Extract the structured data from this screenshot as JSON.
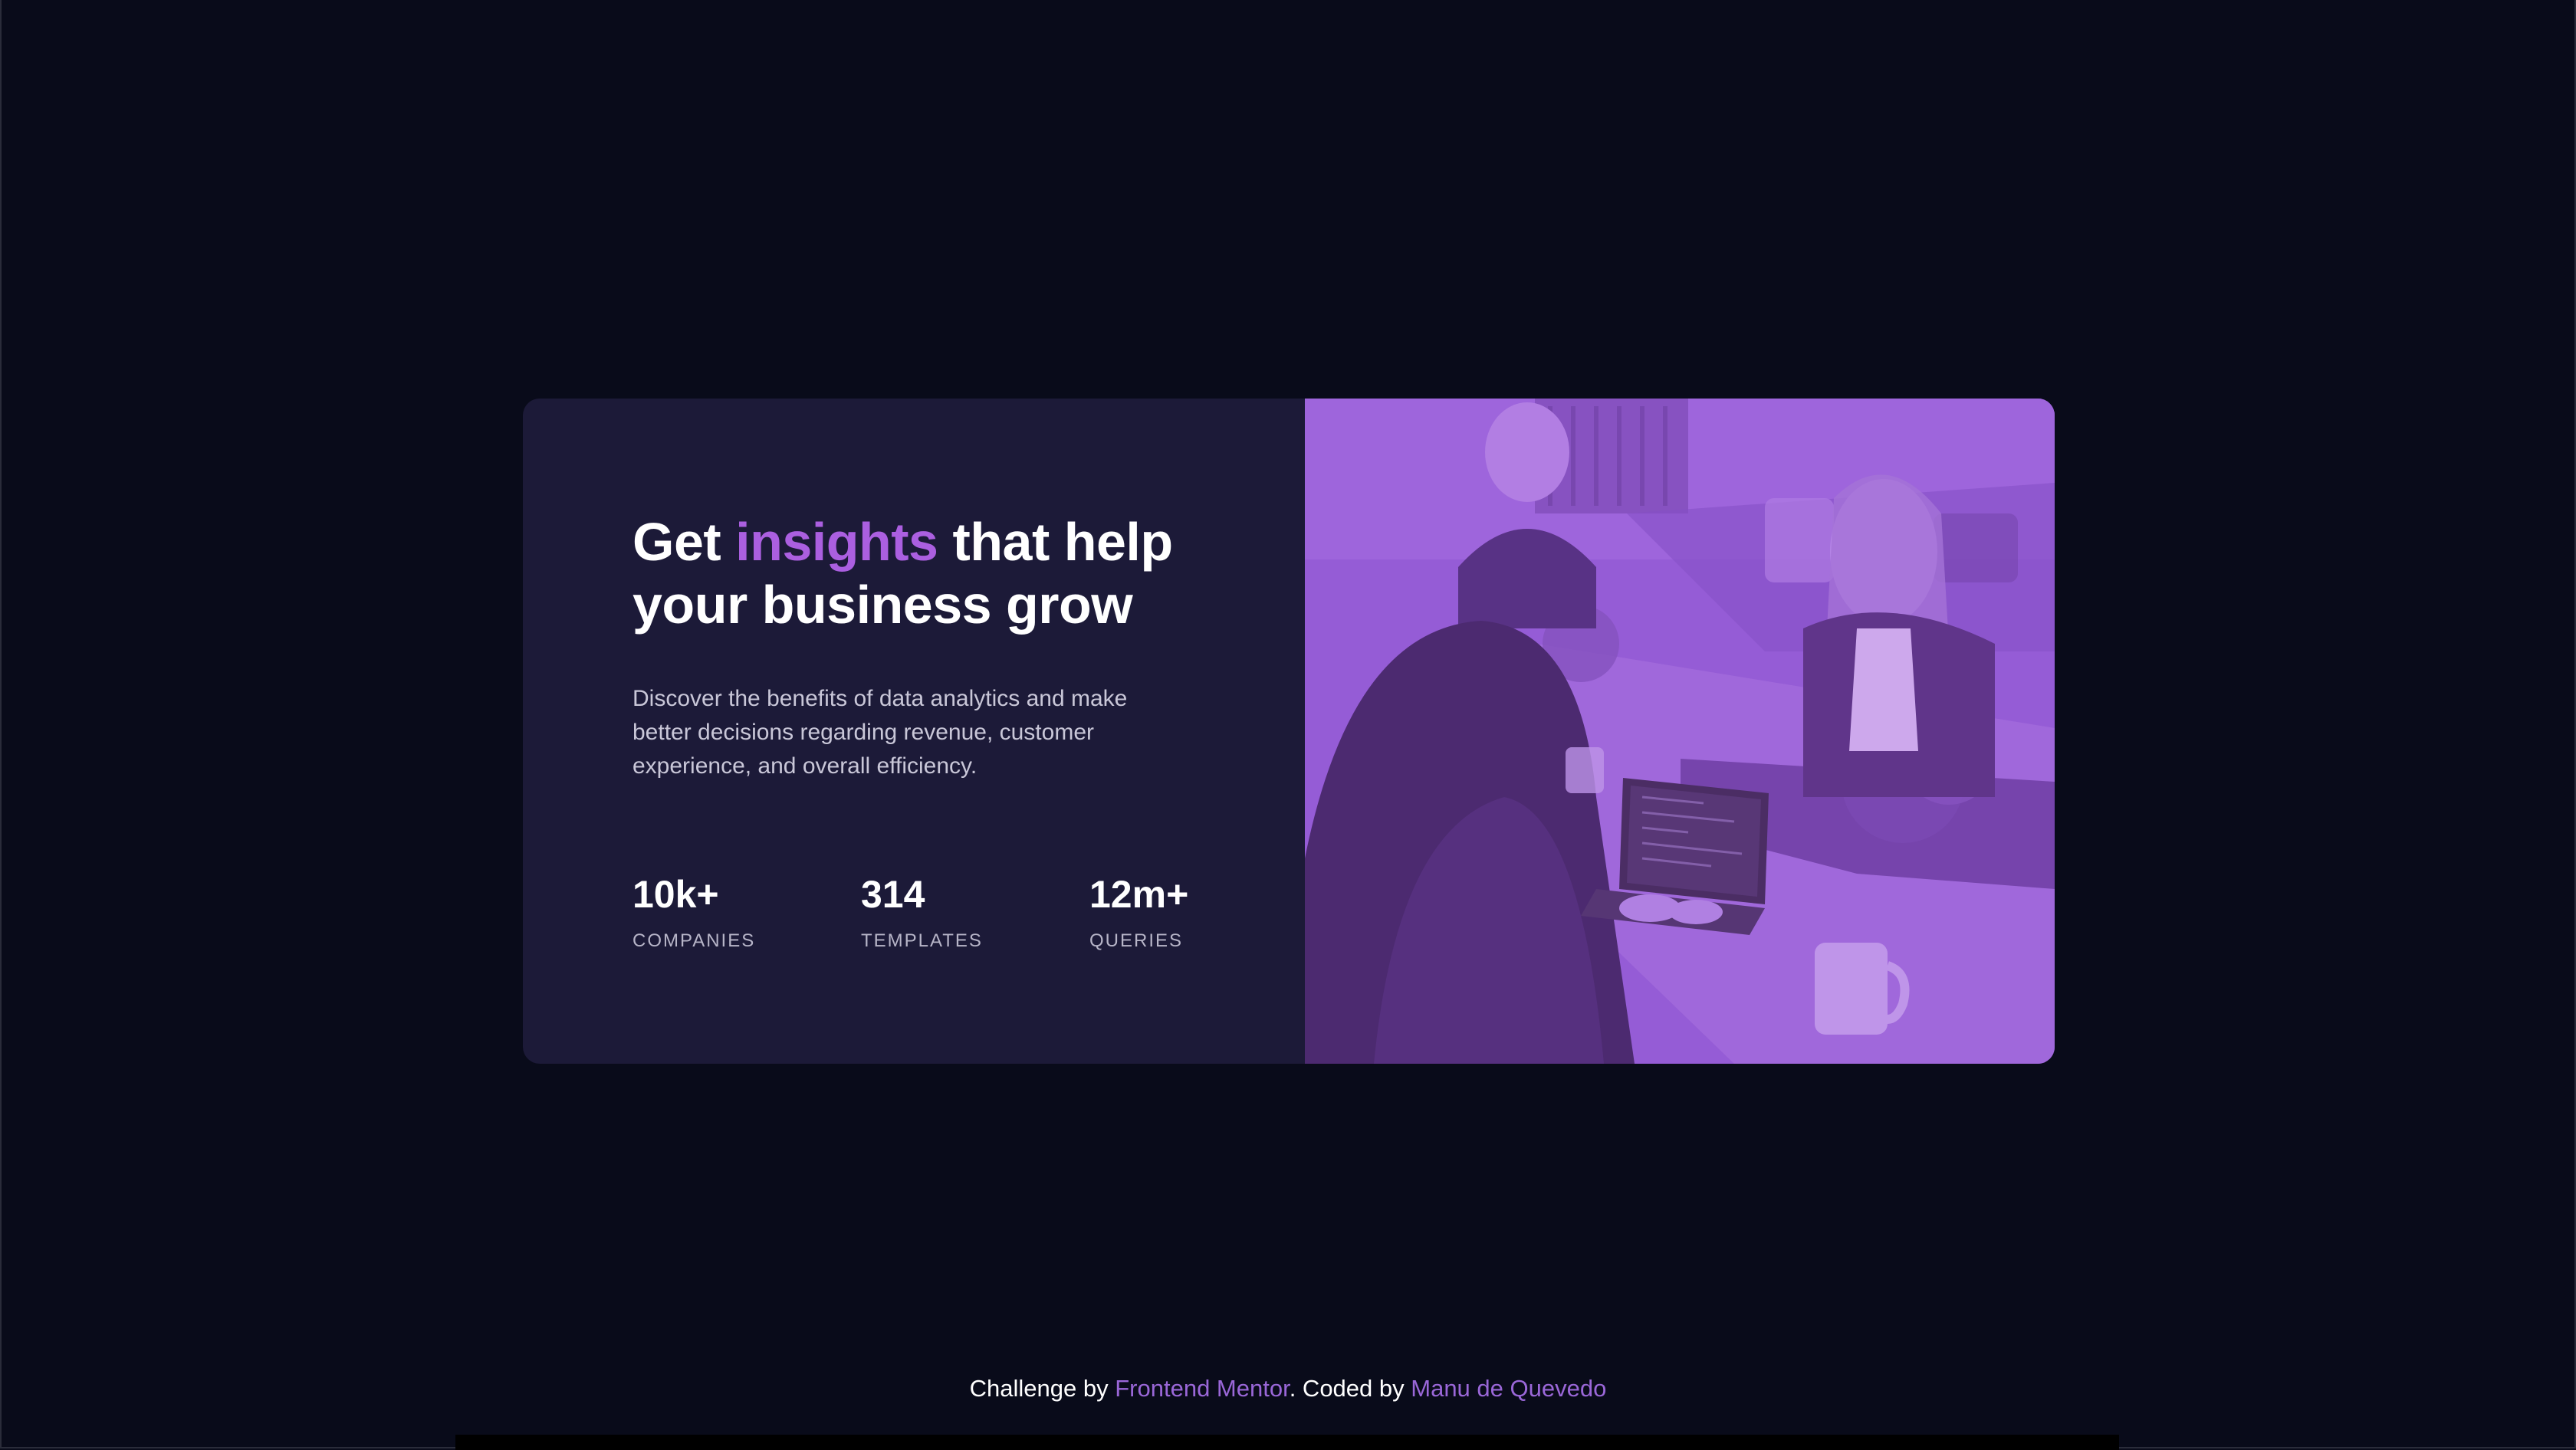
{
  "card": {
    "headline_before": "Get ",
    "headline_accent": "insights",
    "headline_after": " that help your business grow",
    "description": "Discover the benefits of data analytics and make better decisions regarding revenue, customer experience, and overall efficiency.",
    "stats": [
      {
        "value": "10k+",
        "label": "COMPANIES"
      },
      {
        "value": "314",
        "label": "TEMPLATES"
      },
      {
        "value": "12m+",
        "label": "QUERIES"
      }
    ],
    "image_alt": "Women working at a table with laptops"
  },
  "footer": {
    "prefix": "Challenge by ",
    "link1": "Frontend Mentor",
    "middle": ". Coded by ",
    "link2": "Manu de Quevedo"
  },
  "colors": {
    "background": "#090b1a",
    "card": "#1c1a38",
    "accent": "#ab5fe0",
    "image_tint": "#8b5ad1"
  }
}
